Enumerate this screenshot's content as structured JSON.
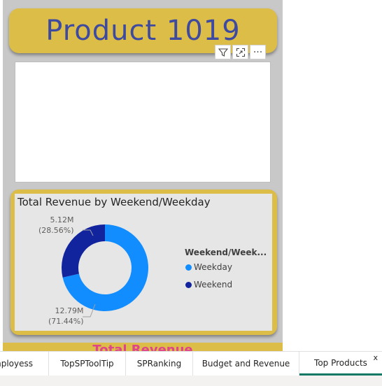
{
  "title": "Product 1019",
  "visual_header": {
    "filter_icon": "filter-icon",
    "focus_icon": "focus-mode-icon",
    "more_icon": "more-options-icon",
    "more_label": "···"
  },
  "donut": {
    "title": "Total Revenue by Weekend/Weekday",
    "legend_title": "Weekend/Week...",
    "labels": {
      "weekend_value": "5.12M",
      "weekend_pct": "(28.56%)",
      "weekday_value": "12.79M",
      "weekday_pct": "(71.44%)"
    },
    "colors": {
      "Weekday": "#118dff",
      "Weekend": "#12239e"
    }
  },
  "chart_data": {
    "type": "pie",
    "title": "Total Revenue by Weekend/Weekday",
    "legend_title": "Weekend/Week...",
    "legend_position": "right",
    "series": [
      {
        "name": "Weekday",
        "value": 12.79,
        "percent": 71.44
      },
      {
        "name": "Weekend",
        "value": 5.12,
        "percent": 28.56
      }
    ],
    "unit": "M"
  },
  "bottom_strip_text": "Total Revenue",
  "tabs": [
    {
      "label": "Employess",
      "active": false
    },
    {
      "label": "TopSPToolTip",
      "active": false
    },
    {
      "label": "SPRanking",
      "active": false
    },
    {
      "label": "Budget and Revenue",
      "active": false
    },
    {
      "label": "Top Products",
      "active": true
    }
  ],
  "tab_close_label": "x"
}
